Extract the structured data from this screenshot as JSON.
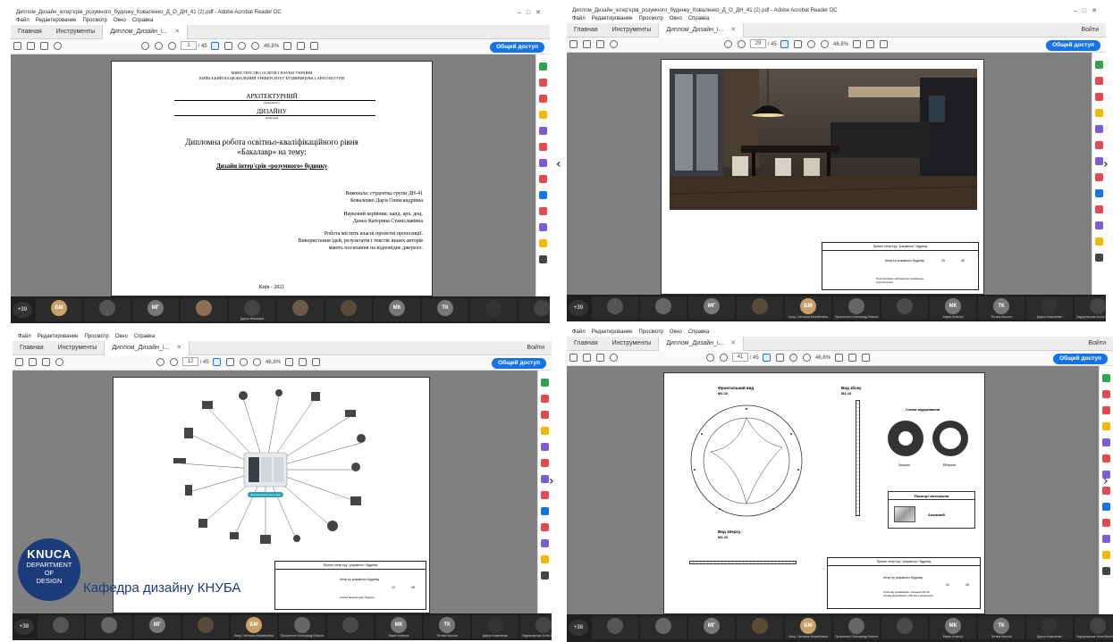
{
  "q1": {
    "window_title": "Диплом_Дизайн_інтер'єрів_розумного_будинку_Коваленко_Д_О_ДН_41 (2).pdf - Adobe Acrobat Reader DC",
    "menu": [
      "Файл",
      "Редактирование",
      "Просмотр",
      "Окно",
      "Справка"
    ],
    "tabs": {
      "home": "Главная",
      "tools": "Инструменты",
      "doc": "Диплом_Дизайн_і..."
    },
    "page_current": "1",
    "page_total": "/ 45",
    "zoom": "46,8%",
    "share": "Общий доступ",
    "doc": {
      "ministry": "МІНІСТЕРСТВО ОСВІТИ І НАУКИ УКРАЇНИ",
      "university": "КИЇВСЬКИЙ НАЦІОНАЛЬНИЙ УНІВЕРСИТЕТ БУДІВНИЦТВА І АРХІТЕКТУРИ",
      "faculty": "АРХІТЕКТУРНИЙ",
      "faculty_note": "(факультет)",
      "chair": "ДИЗАЙНУ",
      "chair_note": "(кафедра)",
      "thesis_l1": "Дипломна робота освітньо-кваліфікаційного рівня",
      "thesis_l2": "«Бакалавр» на тему:",
      "topic": "Дизайн інтер'єрів «розумного» будинку",
      "author_l1": "Виконала: студентка групи ДН-41",
      "author_l2": "Коваленко Дар'я Олександрівна",
      "supervisor_l1": "Науковий керівник: канд. арх. доц.",
      "supervisor_l2": "Даньо Катерина Станіславівна",
      "note_l1": "Робота містить власні проектні пропозиції.",
      "note_l2": "Використання ідей, результатів і текстів інших авторів",
      "note_l3": "мають посилання на відповідне джерело.",
      "city": "Київ - 2021"
    },
    "gallery": {
      "count": "+39",
      "tiles": [
        {
          "initials": "БМ",
          "color": "#c9a06a",
          "name": ""
        },
        {
          "initials": "",
          "color": "#555",
          "name": ""
        },
        {
          "initials": "МГ",
          "color": "#777",
          "name": ""
        },
        {
          "initials": "",
          "color": "#8a6f55",
          "name": ""
        },
        {
          "initials": "",
          "color": "#444",
          "name": "Дарья Жишьков"
        },
        {
          "initials": "",
          "color": "#6b5a4a",
          "name": ""
        },
        {
          "initials": "",
          "color": "#5a4a3a",
          "name": ""
        },
        {
          "initials": "МК",
          "color": "#777",
          "name": ""
        },
        {
          "initials": "ТК",
          "color": "#777",
          "name": ""
        },
        {
          "initials": "",
          "color": "#333",
          "name": ""
        },
        {
          "initials": "",
          "color": "#444",
          "name": ""
        }
      ]
    }
  },
  "q2": {
    "window_title": "Диплом_Дизайн_інтер'єрів_розумного_будинку_Коваленко_Д_О_ДН_41 (2).pdf - Adobe Acrobat Reader DC",
    "menu": [
      "Файл",
      "Редактирование",
      "Просмотр",
      "Окно",
      "Справка"
    ],
    "tabs": {
      "home": "Главная",
      "tools": "Инструменты",
      "doc": "Диплом_Дизайн_і..."
    },
    "page_current": "29",
    "page_total": "/ 45",
    "zoom": "46,8%",
    "share": "Общий доступ",
    "signin": "Войти",
    "tb_title": "Проект інтер'єру \"розумного\" будинку",
    "tb_main": "Інтер'єр розумного будинку",
    "tb_sub": "Перспективне зображення приміщень, кухні-вітальні",
    "tb_page": "29",
    "tb_total": "45",
    "gallery": {
      "count": "+39",
      "tiles": [
        {
          "initials": "",
          "color": "#555",
          "name": ""
        },
        {
          "initials": "",
          "color": "#666",
          "name": ""
        },
        {
          "initials": "МГ",
          "color": "#777",
          "name": ""
        },
        {
          "initials": "",
          "color": "#5a4a3a",
          "name": ""
        },
        {
          "initials": "БМ",
          "color": "#c9a06a",
          "name": "Бець Світлана Михайлівна"
        },
        {
          "initials": "",
          "color": "#666",
          "name": "Прокоптюк Олександр Васильович"
        },
        {
          "initials": "",
          "color": "#4a4a4a",
          "name": ""
        },
        {
          "initials": "МК",
          "color": "#777",
          "name": "Марія Клімчук"
        },
        {
          "initials": "ТК",
          "color": "#777",
          "name": "Тетяна Касьян"
        },
        {
          "initials": "",
          "color": "#333",
          "name": "Дарья Коваленко"
        },
        {
          "initials": "",
          "color": "#444",
          "name": "Задорожьска Алла Валентинівна"
        }
      ]
    }
  },
  "q3": {
    "menu": [
      "Файл",
      "Редактирование",
      "Просмотр",
      "Окно",
      "Справка"
    ],
    "tabs": {
      "home": "Главная",
      "tools": "Инструменты",
      "doc": "Диплом_Дизайн_і..."
    },
    "page_current": "12",
    "page_total": "/ 45",
    "zoom": "46,8%",
    "share": "Общий доступ",
    "signin": "Войти",
    "hub_label": "Центральний контролер",
    "tb_title": "Проект інтер'єру \"розумного\" будинку",
    "tb_main": "Інтер'єр розумного будинку",
    "tb_sub": "Схема функціонуву будинку",
    "tb_page": "12",
    "tb_total": "45",
    "logo": {
      "l1": "KNUCA",
      "l2": "DEPARTMENT",
      "l3": "OF",
      "l4": "DESIGN"
    },
    "caption": "Кафедра дизайну КНУБА",
    "gallery": {
      "count": "+38",
      "tiles": [
        {
          "initials": "",
          "color": "#555",
          "name": ""
        },
        {
          "initials": "",
          "color": "#666",
          "name": ""
        },
        {
          "initials": "МГ",
          "color": "#777",
          "name": ""
        },
        {
          "initials": "",
          "color": "#5a4a3a",
          "name": ""
        },
        {
          "initials": "БМ",
          "color": "#c9a06a",
          "name": "Бець Світлана Михайлівна"
        },
        {
          "initials": "",
          "color": "#666",
          "name": "Прокоптюк Олександр Васильович"
        },
        {
          "initials": "",
          "color": "#4a4a4a",
          "name": ""
        },
        {
          "initials": "МК",
          "color": "#777",
          "name": "Марія Клімчук"
        },
        {
          "initials": "ТК",
          "color": "#777",
          "name": "Тетяна Касьян"
        },
        {
          "initials": "",
          "color": "#333",
          "name": "Дарья Коваленко"
        },
        {
          "initials": "",
          "color": "#444",
          "name": "Задорожьска Алла Валентинівна"
        }
      ]
    }
  },
  "q4": {
    "menu": [
      "Файл",
      "Редактирование",
      "Просмотр",
      "Окно",
      "Справка"
    ],
    "tabs": {
      "home": "Главная",
      "tools": "Инструменты",
      "doc": "Диплом_Дизайн_і..."
    },
    "page_current": "41",
    "page_total": "/ 45",
    "zoom": "46,8%",
    "share": "Общий доступ",
    "signin": "Войти",
    "front": "Фронтальний вид",
    "front_scale": "М1:10",
    "side": "Вид збоку",
    "side_scale": "М1:10",
    "top": "Вид зверху",
    "top_scale": "М1:10",
    "scheme": "Схема відкривання",
    "open_l": "Закрит",
    "open_r": "Відкрит",
    "passport": "Паспорт матеріалів",
    "material": "Алюміній",
    "tb_title": "Проект інтер'єру \"розумного\" будинку",
    "tb_main": "Інтер'єр розумного будинку",
    "tb_sub": "Приклад дизайнового рішення МК.10. Схема відкривання. Паспорт матеріалів",
    "tb_page": "41",
    "tb_total": "45",
    "gallery": {
      "count": "+38",
      "tiles": [
        {
          "initials": "",
          "color": "#555",
          "name": ""
        },
        {
          "initials": "",
          "color": "#666",
          "name": ""
        },
        {
          "initials": "МГ",
          "color": "#777",
          "name": ""
        },
        {
          "initials": "",
          "color": "#5a4a3a",
          "name": ""
        },
        {
          "initials": "БМ",
          "color": "#c9a06a",
          "name": "Бець Світлана Михайлівна"
        },
        {
          "initials": "",
          "color": "#666",
          "name": "Прокоптюк Олександр Васильович"
        },
        {
          "initials": "",
          "color": "#4a4a4a",
          "name": ""
        },
        {
          "initials": "МК",
          "color": "#777",
          "name": "Марія Клімчук"
        },
        {
          "initials": "ТК",
          "color": "#777",
          "name": "Тетяна Касьян"
        },
        {
          "initials": "",
          "color": "#333",
          "name": "Дарья Коваленко"
        },
        {
          "initials": "",
          "color": "#444",
          "name": "Задорожьска Алла Валентинівна"
        }
      ]
    }
  },
  "colors": {
    "accent": "#1473e6",
    "gallery_bg": "#1f1f1f",
    "workspace": "#808080"
  }
}
